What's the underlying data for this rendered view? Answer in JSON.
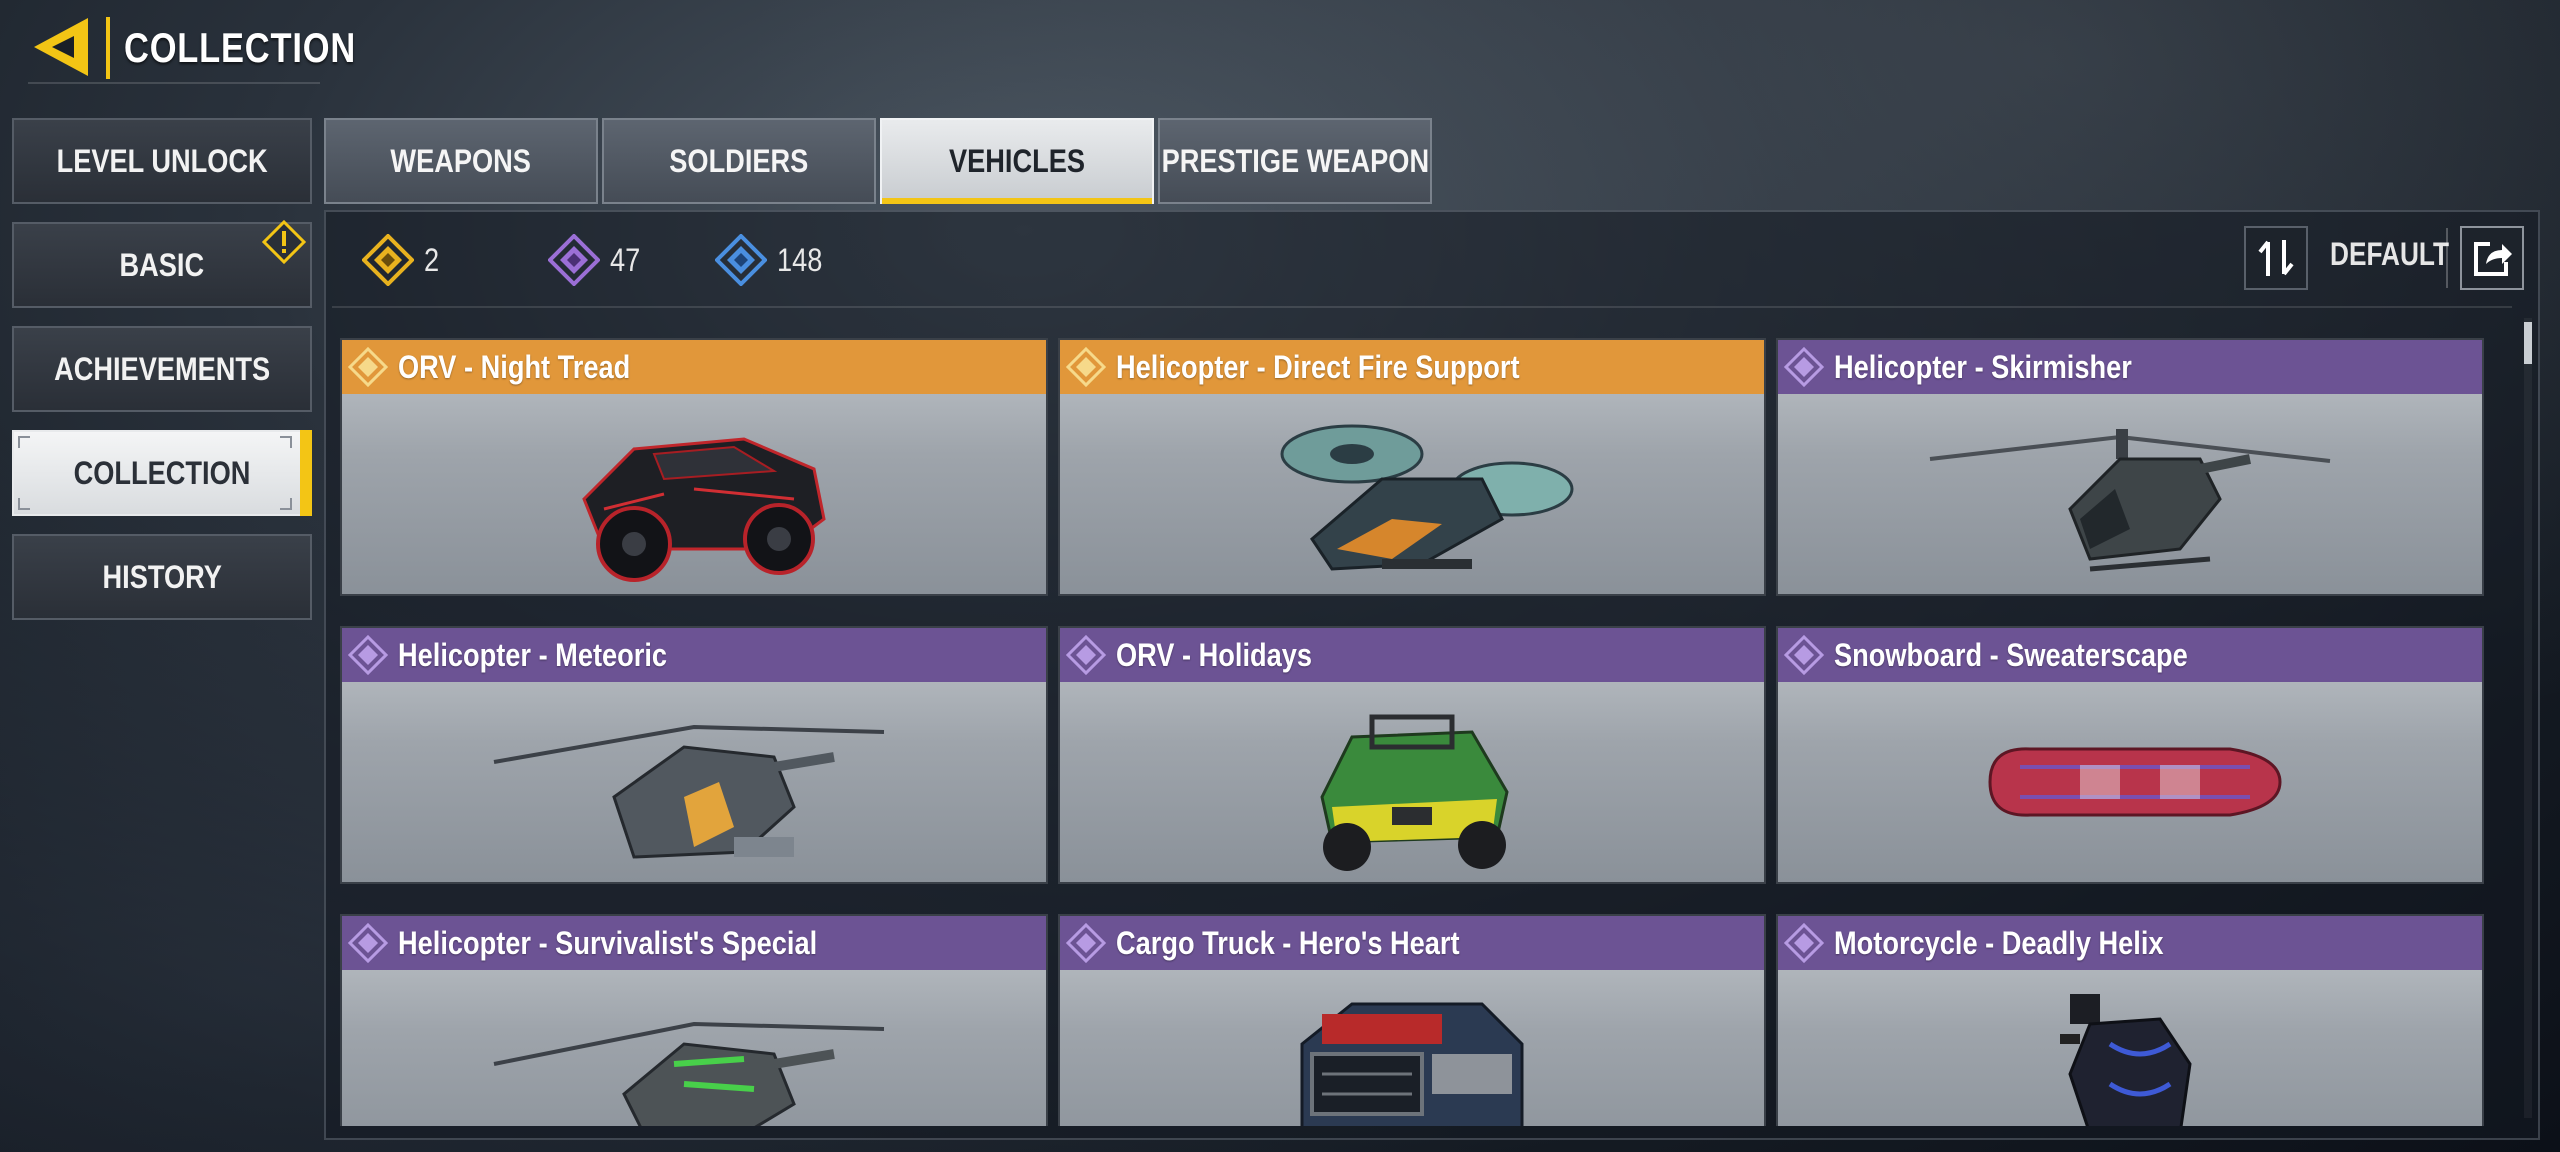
{
  "header": {
    "title": "COLLECTION"
  },
  "sidebar": {
    "items": [
      {
        "label": "LEVEL UNLOCK",
        "active": false
      },
      {
        "label": "BASIC",
        "active": false,
        "badge": "warning"
      },
      {
        "label": "ACHIEVEMENTS",
        "active": false
      },
      {
        "label": "COLLECTION",
        "active": true
      },
      {
        "label": "HISTORY",
        "active": false
      }
    ]
  },
  "tabs": [
    {
      "label": "WEAPONS",
      "active": false
    },
    {
      "label": "SOLDIERS",
      "active": false
    },
    {
      "label": "VEHICLES",
      "active": true
    },
    {
      "label": "PRESTIGE WEAPON",
      "active": false
    }
  ],
  "counters": [
    {
      "rarity": "legendary",
      "color": "#e8b21f",
      "value": "2"
    },
    {
      "rarity": "epic",
      "color": "#9b6fd6",
      "value": "47"
    },
    {
      "rarity": "rare",
      "color": "#4a8fe0",
      "value": "148"
    }
  ],
  "sort": {
    "label": "DEFAULT",
    "sort_icon": "sort-arrows-icon",
    "share_icon": "share-icon"
  },
  "cards": [
    {
      "title": "ORV - Night Tread",
      "rarity": "gold",
      "image": "orv-vehicle"
    },
    {
      "title": "Helicopter - Direct Fire Support",
      "rarity": "gold",
      "image": "gunship"
    },
    {
      "title": "Helicopter - Skirmisher",
      "rarity": "purple",
      "image": "helicopter"
    },
    {
      "title": "Helicopter - Meteoric",
      "rarity": "purple",
      "image": "helicopter"
    },
    {
      "title": "ORV - Holidays",
      "rarity": "purple",
      "image": "orv-buggy"
    },
    {
      "title": "Snowboard - Sweaterscape",
      "rarity": "purple",
      "image": "snowboard"
    },
    {
      "title": "Helicopter - Survivalist's Special",
      "rarity": "purple",
      "image": "helicopter"
    },
    {
      "title": "Cargo Truck - Hero's Heart",
      "rarity": "purple",
      "image": "truck"
    },
    {
      "title": "Motorcycle - Deadly Helix",
      "rarity": "purple",
      "image": "motorcycle"
    }
  ]
}
